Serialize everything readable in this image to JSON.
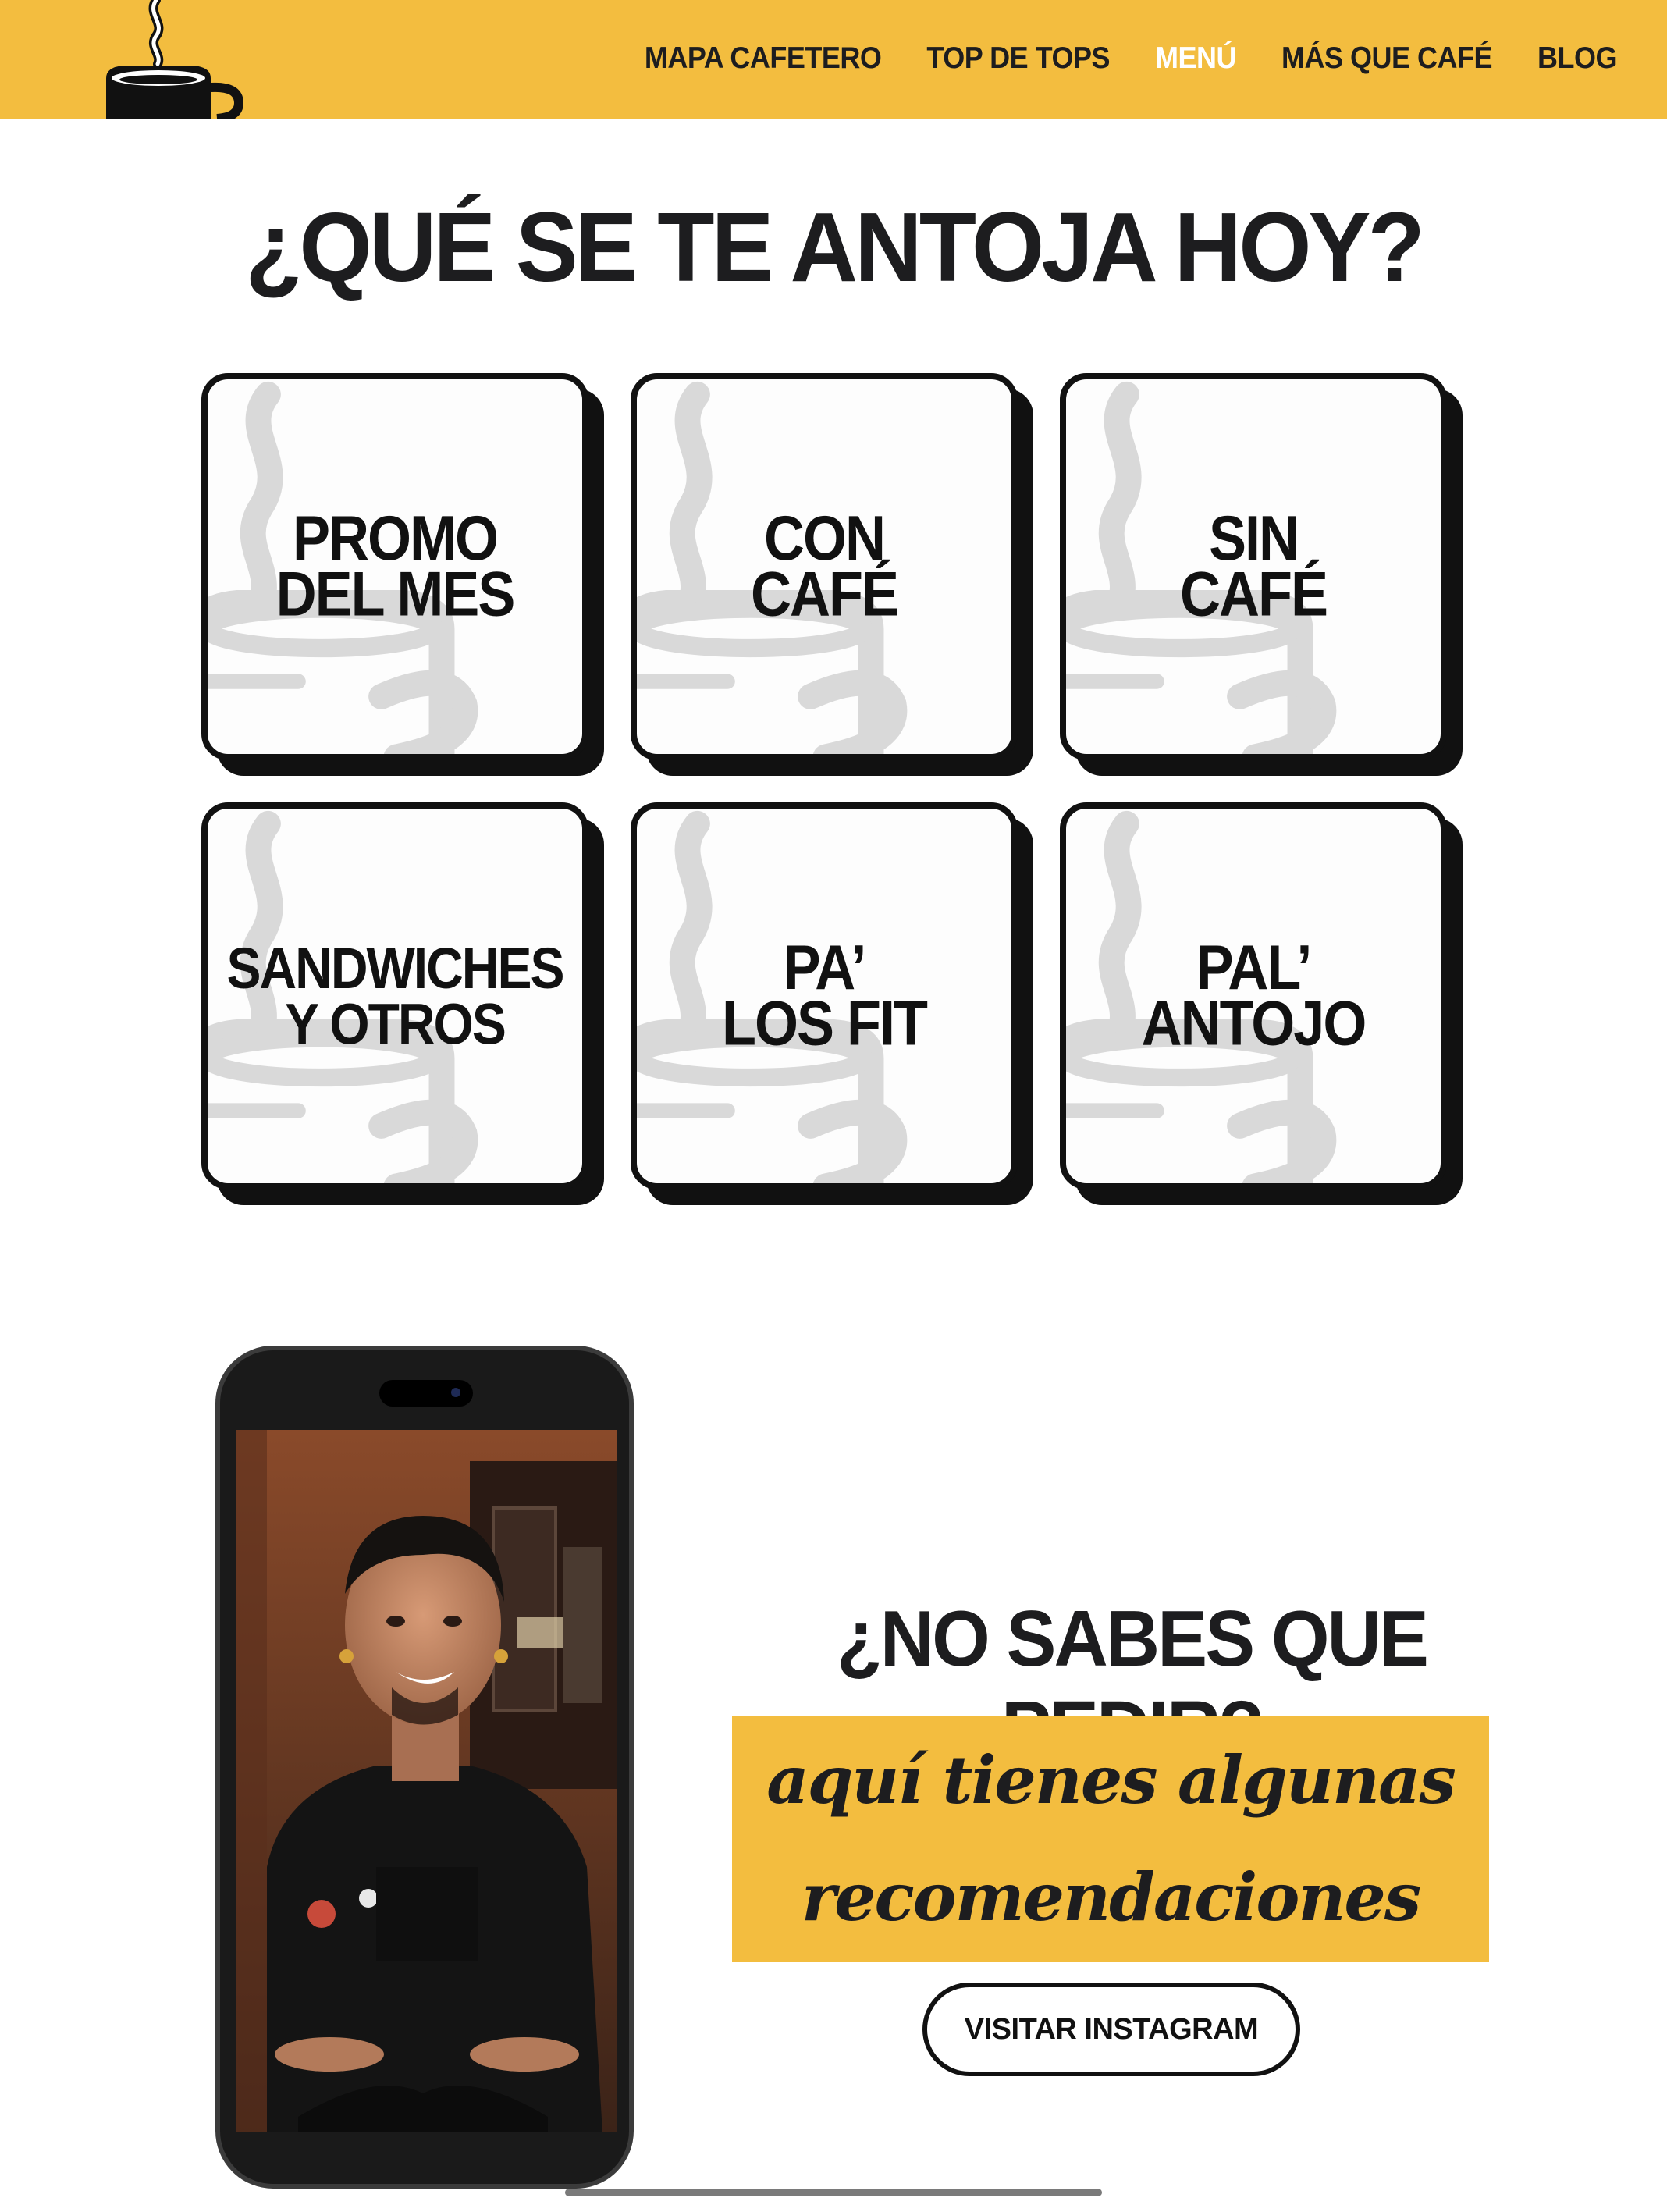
{
  "header": {
    "nav": [
      "MAPA CAFETERO",
      "TOP DE TOPS",
      "MENÚ",
      "MÁS QUE CAFÉ",
      "BLOG"
    ],
    "active_item": "MENÚ",
    "logo_icon": "coffee-cup-icon"
  },
  "menu": {
    "title": "¿QUÉ SE TE ANTOJA HOY?",
    "cards": [
      {
        "label": "PROMO\nDEL MES"
      },
      {
        "label": "CON\nCAFÉ"
      },
      {
        "label": "SIN\nCAFÉ"
      },
      {
        "label": "SANDWICHES\nY OTROS"
      },
      {
        "label": "PA’\nLOS FIT"
      },
      {
        "label": "PAL’\nANTOJO"
      }
    ]
  },
  "cta": {
    "title": "¿NO SABES QUE PEDIR?",
    "subtitle": "aquí tienes algunas recomendaciones",
    "button": "VISITAR INSTAGRAM"
  },
  "colors": {
    "accent": "#f3bd3f",
    "ink": "#1d1d1f",
    "card_bg": "#fdfdfd",
    "cup_watermark": "#d9d9d9"
  }
}
